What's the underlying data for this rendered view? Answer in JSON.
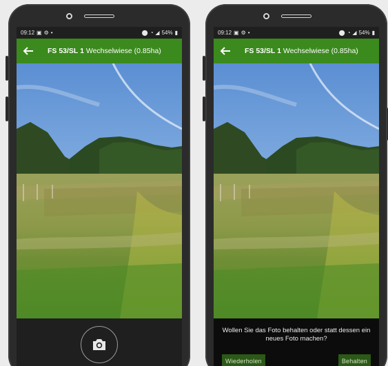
{
  "status_bar": {
    "time": "09:12",
    "battery": "54%"
  },
  "app_bar": {
    "field_id": "FS 53/SL 1",
    "field_name": "Wechselwiese (0.85ha)"
  },
  "confirm_dialog": {
    "message": "Wollen Sie das Foto behalten oder statt dessen ein neues Foto machen?",
    "retake_label": "Wiederholen",
    "keep_label": "Behalten"
  },
  "colors": {
    "app_bar": "#3b8a1d",
    "button_bg": "#2c5818"
  },
  "icons": [
    "back-arrow-icon",
    "camera-icon",
    "image-icon",
    "gear-icon",
    "location-icon",
    "wifi-icon",
    "signal-icon",
    "battery-icon"
  ]
}
